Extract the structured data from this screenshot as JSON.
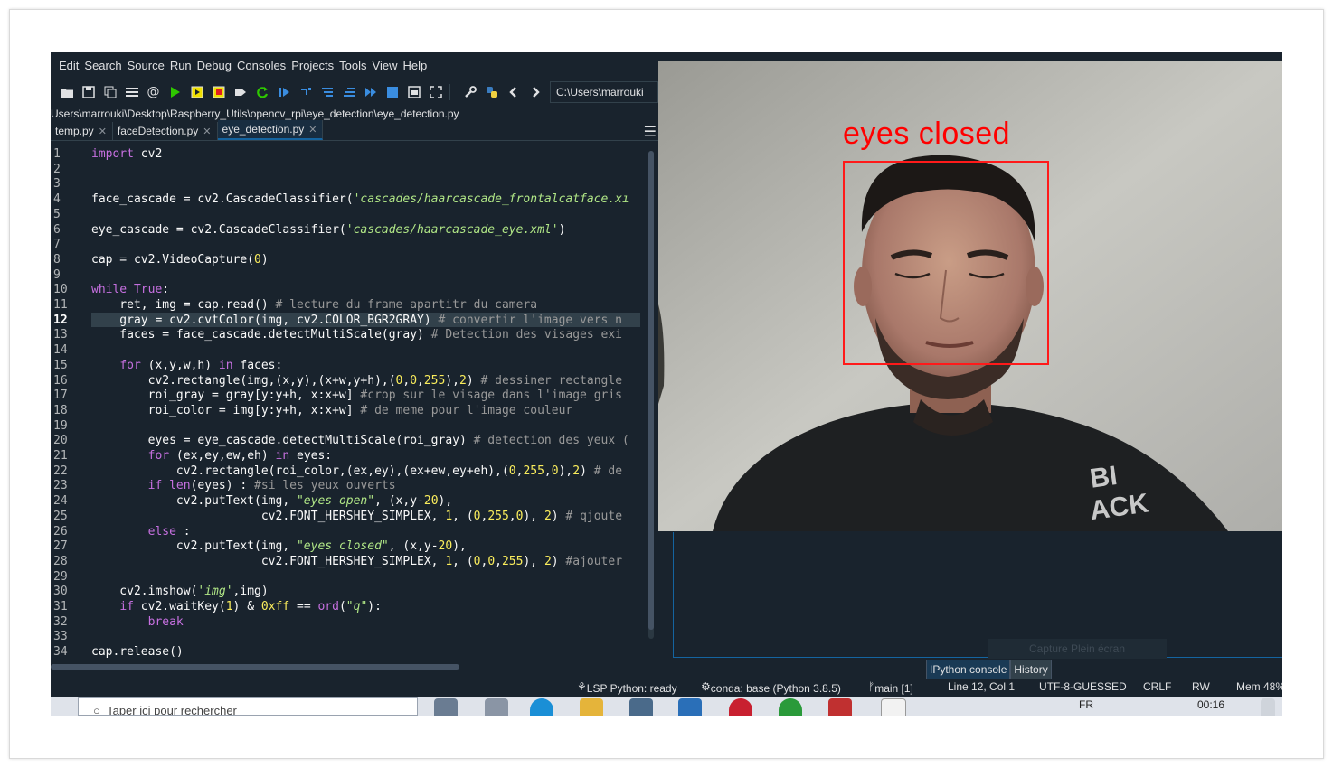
{
  "menu": [
    "Edit",
    "Search",
    "Source",
    "Run",
    "Debug",
    "Consoles",
    "Projects",
    "Tools",
    "View",
    "Help"
  ],
  "toolbar": {
    "path": "C:\\Users\\marrouki"
  },
  "filepath": "Users\\marrouki\\Desktop\\Raspberry_Utils\\opencv_rpi\\eye_detection\\eye_detection.py",
  "tabs": [
    "temp.py",
    "faceDetection.py",
    "eye_detection.py"
  ],
  "code": {
    "line_numbers": [
      "1",
      "2",
      "3",
      "4",
      "5",
      "6",
      "7",
      "8",
      "9",
      "10",
      "11",
      "12",
      "13",
      "14",
      "15",
      "16",
      "17",
      "18",
      "19",
      "20",
      "21",
      "22",
      "23",
      "24",
      "25",
      "26",
      "27",
      "28",
      "29",
      "30",
      "31",
      "32",
      "33",
      "34"
    ],
    "current_line": "12"
  },
  "camera": {
    "overlay_text": "eyes closed"
  },
  "ghost_button": "Capture Plein écran",
  "console_tabs": [
    "IPython console",
    "History"
  ],
  "status": {
    "lsp": "LSP Python: ready",
    "conda": "conda: base (Python 3.8.5)",
    "git": "main [1]",
    "position": "Line 12, Col 1",
    "encoding": "UTF-8-GUESSED",
    "eol": "CRLF",
    "perm": "RW",
    "mem": "Mem 48%"
  },
  "taskbar": {
    "search_placeholder": "Taper ici pour rechercher",
    "lang": "FR",
    "time": "00:16"
  },
  "colors": {
    "editor_bg": "#19232d",
    "keyword": "#c670e0",
    "string": "#b0e686",
    "number": "#faed5c",
    "comment": "#999999",
    "face_box": "#ff0000"
  }
}
